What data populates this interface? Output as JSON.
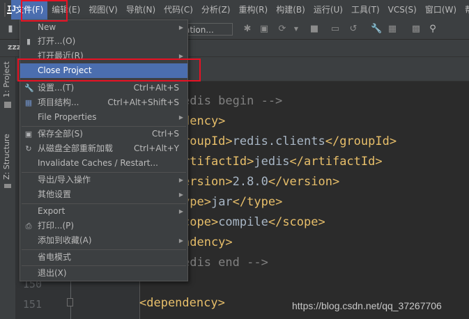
{
  "menubar": {
    "logo": "IJ",
    "items": [
      "文件(F)",
      "编辑(E)",
      "视图(V)",
      "导航(N)",
      "代码(C)",
      "分析(Z)",
      "重构(R)",
      "构建(B)",
      "运行(U)",
      "工具(T)",
      "VCS(S)",
      "窗口(W)",
      "帮"
    ]
  },
  "toolbar": {
    "run_config": "ation..."
  },
  "navbar": {
    "crumb": "zzz"
  },
  "sidebar": {
    "project_tab": "1: Project",
    "structure_tab": "Z: Structure"
  },
  "dropdown": {
    "new": {
      "label": "New"
    },
    "open": {
      "label": "打开...(O)"
    },
    "recent": {
      "label": "打开最近(R)"
    },
    "close_project": {
      "label": "Close Project"
    },
    "settings": {
      "label": "设置...(T)",
      "shortcut": "Ctrl+Alt+S"
    },
    "project_structure": {
      "label": "项目结构...",
      "shortcut": "Ctrl+Alt+Shift+S"
    },
    "file_properties": {
      "label": "File Properties"
    },
    "save_all": {
      "label": "保存全部(S)",
      "shortcut": "Ctrl+S"
    },
    "reload": {
      "label": "从磁盘全部重新加载",
      "shortcut": "Ctrl+Alt+Y"
    },
    "invalidate": {
      "label": "Invalidate Caches / Restart..."
    },
    "import_export": {
      "label": "导出/导入操作"
    },
    "other_settings": {
      "label": "其他设置"
    },
    "export": {
      "label": "Export"
    },
    "print": {
      "label": "打印...(P)"
    },
    "add_favorites": {
      "label": "添加到收藏(A)"
    },
    "power_save": {
      "label": "省电模式"
    },
    "exit": {
      "label": "退出(X)"
    }
  },
  "editor": {
    "line_numbers": [
      "150",
      "151"
    ],
    "lines": {
      "l1": {
        "a": "edis begin -->"
      },
      "l2": {
        "a": "dency>"
      },
      "l3": {
        "a": "roupId>",
        "b": "redis.clients",
        "c": "</groupId>"
      },
      "l4": {
        "a": "rtifactId>",
        "b": "jedis",
        "c": "</artifactId>"
      },
      "l5": {
        "a": "ersion>",
        "b": "2.8.0",
        "c": "</version>"
      },
      "l6": {
        "a": "ype>",
        "b": "jar",
        "c": "</type>"
      },
      "l7": {
        "a": "cope>",
        "b": "compile",
        "c": "</scope>"
      },
      "l8": {
        "a": "ndency>"
      },
      "l9": {
        "a": "edis end -->"
      },
      "l10": {
        "a": "<dependency>"
      }
    }
  },
  "watermark": "https://blog.csdn.net/qq_37267706",
  "colors": {
    "accent": "#4b6eaf",
    "highlight_box": "#e81123",
    "tag": "#e8bf6a",
    "comment": "#808080"
  }
}
